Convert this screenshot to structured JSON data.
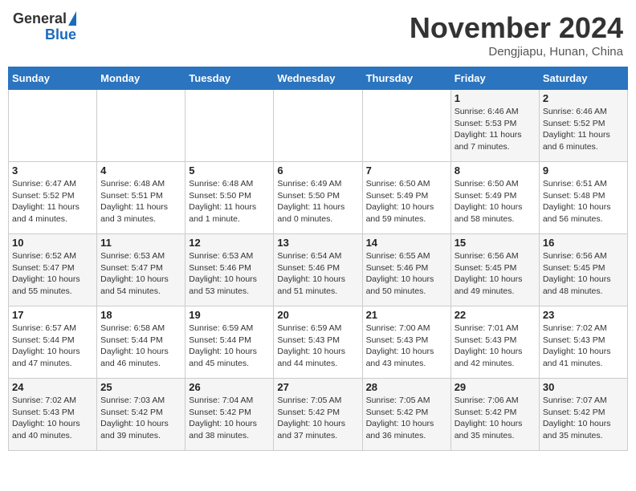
{
  "header": {
    "logo_line1": "General",
    "logo_line2": "Blue",
    "month": "November 2024",
    "location": "Dengjiapu, Hunan, China"
  },
  "weekdays": [
    "Sunday",
    "Monday",
    "Tuesday",
    "Wednesday",
    "Thursday",
    "Friday",
    "Saturday"
  ],
  "weeks": [
    [
      {
        "day": "",
        "info": ""
      },
      {
        "day": "",
        "info": ""
      },
      {
        "day": "",
        "info": ""
      },
      {
        "day": "",
        "info": ""
      },
      {
        "day": "",
        "info": ""
      },
      {
        "day": "1",
        "info": "Sunrise: 6:46 AM\nSunset: 5:53 PM\nDaylight: 11 hours\nand 7 minutes."
      },
      {
        "day": "2",
        "info": "Sunrise: 6:46 AM\nSunset: 5:52 PM\nDaylight: 11 hours\nand 6 minutes."
      }
    ],
    [
      {
        "day": "3",
        "info": "Sunrise: 6:47 AM\nSunset: 5:52 PM\nDaylight: 11 hours\nand 4 minutes."
      },
      {
        "day": "4",
        "info": "Sunrise: 6:48 AM\nSunset: 5:51 PM\nDaylight: 11 hours\nand 3 minutes."
      },
      {
        "day": "5",
        "info": "Sunrise: 6:48 AM\nSunset: 5:50 PM\nDaylight: 11 hours\nand 1 minute."
      },
      {
        "day": "6",
        "info": "Sunrise: 6:49 AM\nSunset: 5:50 PM\nDaylight: 11 hours\nand 0 minutes."
      },
      {
        "day": "7",
        "info": "Sunrise: 6:50 AM\nSunset: 5:49 PM\nDaylight: 10 hours\nand 59 minutes."
      },
      {
        "day": "8",
        "info": "Sunrise: 6:50 AM\nSunset: 5:49 PM\nDaylight: 10 hours\nand 58 minutes."
      },
      {
        "day": "9",
        "info": "Sunrise: 6:51 AM\nSunset: 5:48 PM\nDaylight: 10 hours\nand 56 minutes."
      }
    ],
    [
      {
        "day": "10",
        "info": "Sunrise: 6:52 AM\nSunset: 5:47 PM\nDaylight: 10 hours\nand 55 minutes."
      },
      {
        "day": "11",
        "info": "Sunrise: 6:53 AM\nSunset: 5:47 PM\nDaylight: 10 hours\nand 54 minutes."
      },
      {
        "day": "12",
        "info": "Sunrise: 6:53 AM\nSunset: 5:46 PM\nDaylight: 10 hours\nand 53 minutes."
      },
      {
        "day": "13",
        "info": "Sunrise: 6:54 AM\nSunset: 5:46 PM\nDaylight: 10 hours\nand 51 minutes."
      },
      {
        "day": "14",
        "info": "Sunrise: 6:55 AM\nSunset: 5:46 PM\nDaylight: 10 hours\nand 50 minutes."
      },
      {
        "day": "15",
        "info": "Sunrise: 6:56 AM\nSunset: 5:45 PM\nDaylight: 10 hours\nand 49 minutes."
      },
      {
        "day": "16",
        "info": "Sunrise: 6:56 AM\nSunset: 5:45 PM\nDaylight: 10 hours\nand 48 minutes."
      }
    ],
    [
      {
        "day": "17",
        "info": "Sunrise: 6:57 AM\nSunset: 5:44 PM\nDaylight: 10 hours\nand 47 minutes."
      },
      {
        "day": "18",
        "info": "Sunrise: 6:58 AM\nSunset: 5:44 PM\nDaylight: 10 hours\nand 46 minutes."
      },
      {
        "day": "19",
        "info": "Sunrise: 6:59 AM\nSunset: 5:44 PM\nDaylight: 10 hours\nand 45 minutes."
      },
      {
        "day": "20",
        "info": "Sunrise: 6:59 AM\nSunset: 5:43 PM\nDaylight: 10 hours\nand 44 minutes."
      },
      {
        "day": "21",
        "info": "Sunrise: 7:00 AM\nSunset: 5:43 PM\nDaylight: 10 hours\nand 43 minutes."
      },
      {
        "day": "22",
        "info": "Sunrise: 7:01 AM\nSunset: 5:43 PM\nDaylight: 10 hours\nand 42 minutes."
      },
      {
        "day": "23",
        "info": "Sunrise: 7:02 AM\nSunset: 5:43 PM\nDaylight: 10 hours\nand 41 minutes."
      }
    ],
    [
      {
        "day": "24",
        "info": "Sunrise: 7:02 AM\nSunset: 5:43 PM\nDaylight: 10 hours\nand 40 minutes."
      },
      {
        "day": "25",
        "info": "Sunrise: 7:03 AM\nSunset: 5:42 PM\nDaylight: 10 hours\nand 39 minutes."
      },
      {
        "day": "26",
        "info": "Sunrise: 7:04 AM\nSunset: 5:42 PM\nDaylight: 10 hours\nand 38 minutes."
      },
      {
        "day": "27",
        "info": "Sunrise: 7:05 AM\nSunset: 5:42 PM\nDaylight: 10 hours\nand 37 minutes."
      },
      {
        "day": "28",
        "info": "Sunrise: 7:05 AM\nSunset: 5:42 PM\nDaylight: 10 hours\nand 36 minutes."
      },
      {
        "day": "29",
        "info": "Sunrise: 7:06 AM\nSunset: 5:42 PM\nDaylight: 10 hours\nand 35 minutes."
      },
      {
        "day": "30",
        "info": "Sunrise: 7:07 AM\nSunset: 5:42 PM\nDaylight: 10 hours\nand 35 minutes."
      }
    ]
  ]
}
